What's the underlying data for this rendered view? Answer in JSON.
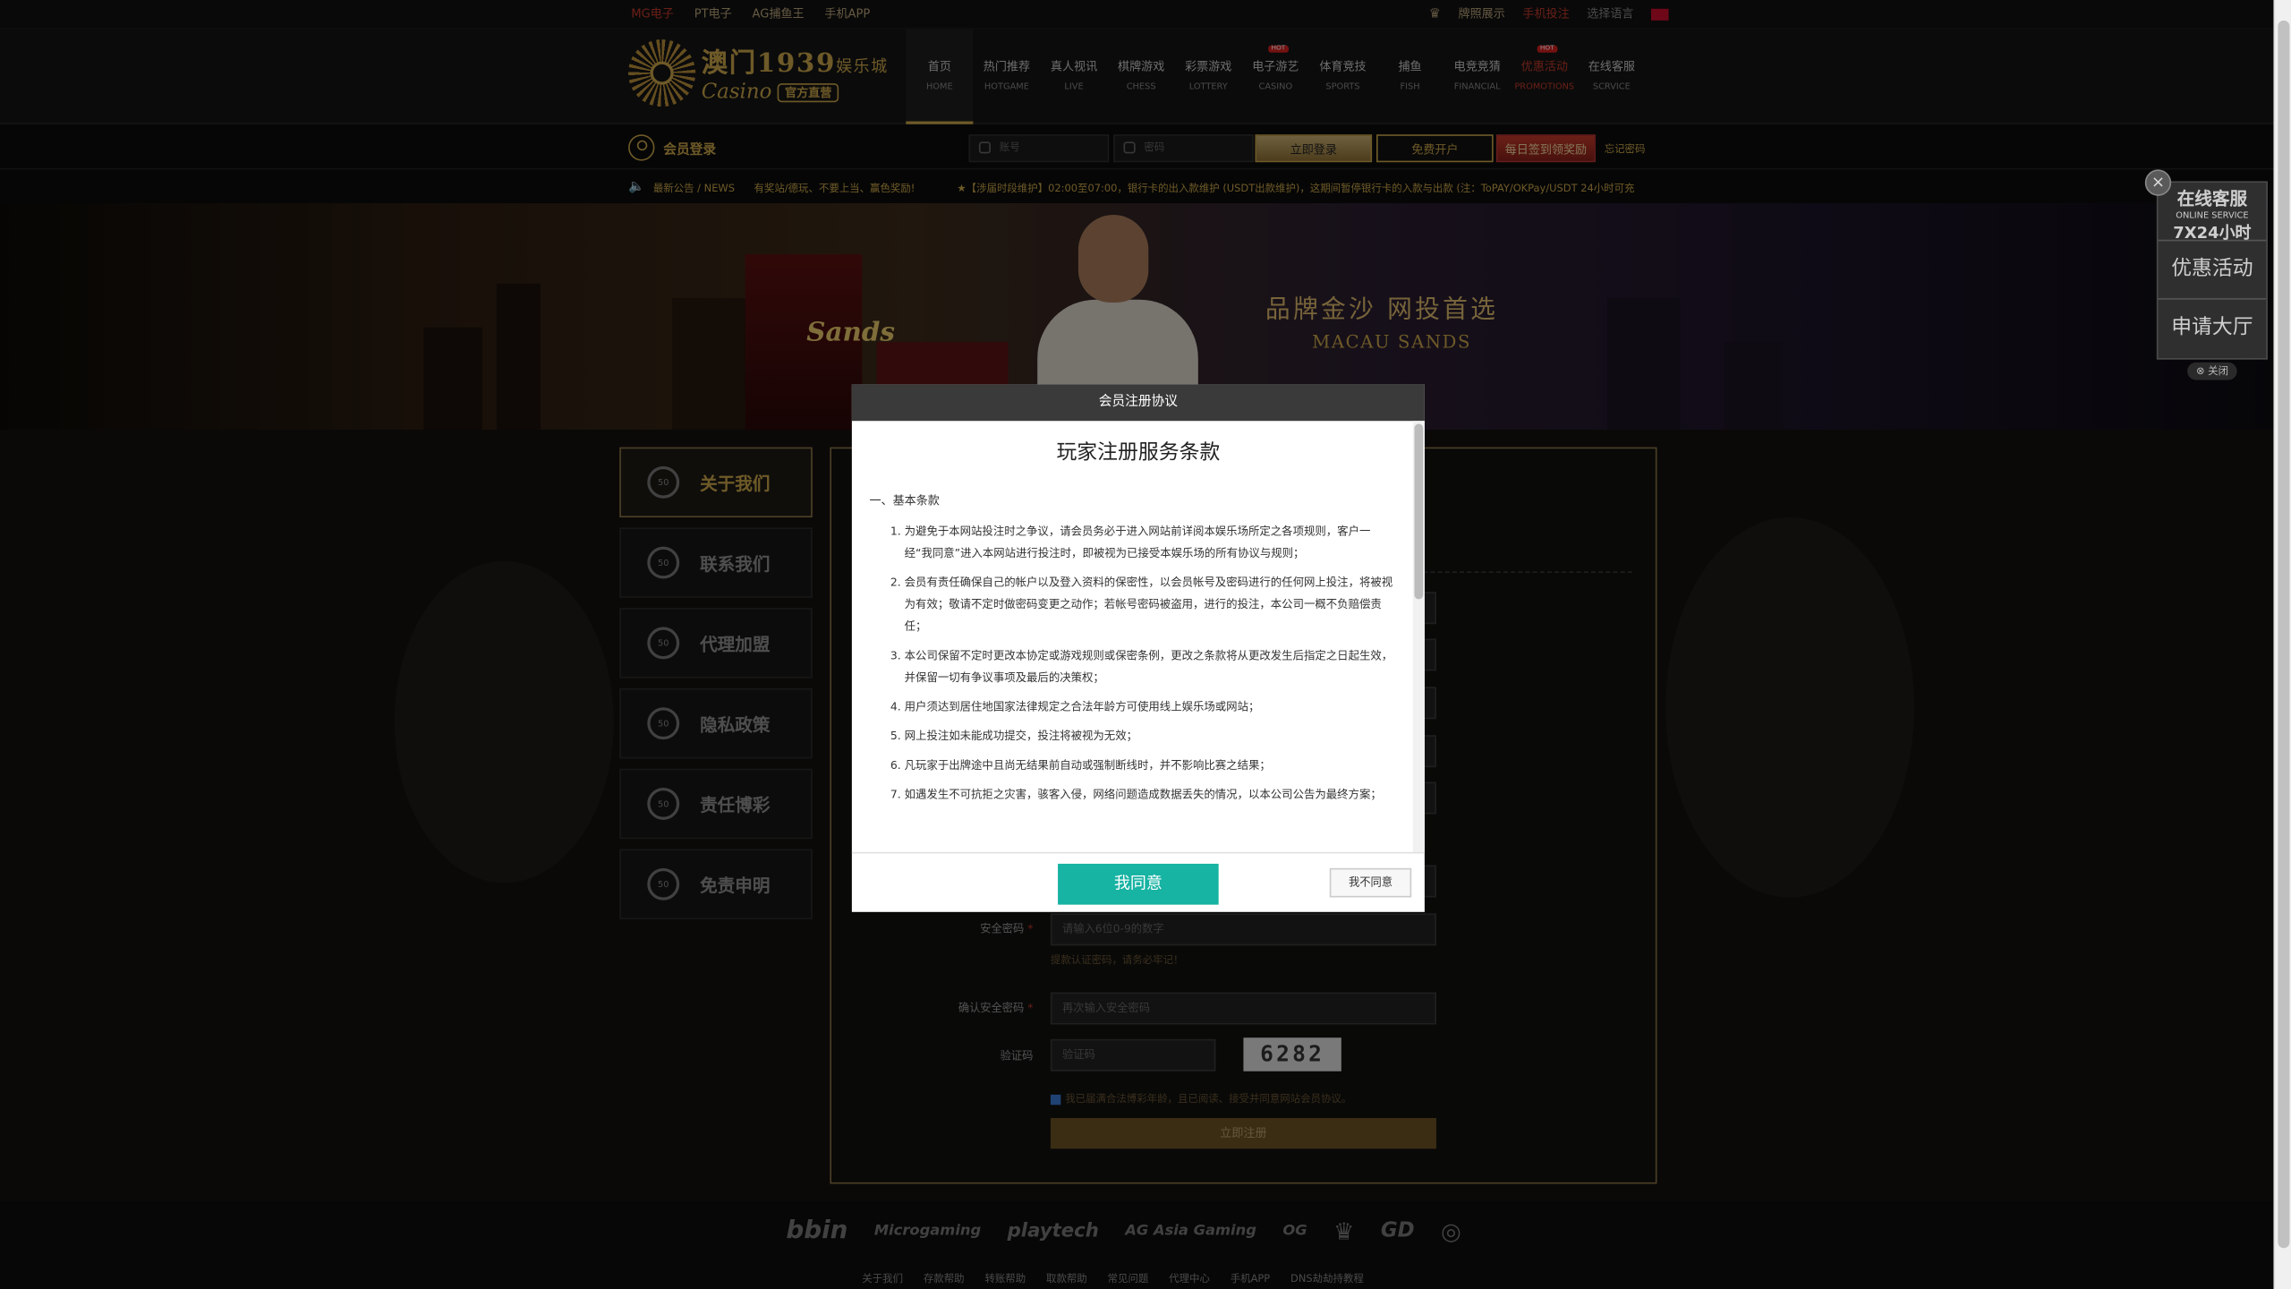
{
  "topbar": {
    "links": [
      "MG电子",
      "PT电子",
      "AG捕鱼王",
      "手机APP"
    ],
    "right": [
      "牌照展示",
      "手机投注",
      "选择语言"
    ]
  },
  "logo": {
    "main": "澳门1939",
    "suffix": "娱乐城",
    "casino": "Casino",
    "badge": "官方直营"
  },
  "nav": [
    {
      "zh": "首页",
      "en": "HOME"
    },
    {
      "zh": "热门推荐",
      "en": "HOTGAME"
    },
    {
      "zh": "真人视讯",
      "en": "LIVE"
    },
    {
      "zh": "棋牌游戏",
      "en": "CHESS"
    },
    {
      "zh": "彩票游戏",
      "en": "LOTTERY"
    },
    {
      "zh": "电子游艺",
      "en": "CASINO",
      "hot": "HOT"
    },
    {
      "zh": "体育竞技",
      "en": "SPORTS"
    },
    {
      "zh": "捕鱼",
      "en": "FISH"
    },
    {
      "zh": "电竞竞猜",
      "en": "FINANCIAL"
    },
    {
      "zh": "优惠活动",
      "en": "PROMOTIONS",
      "hot": "HOT"
    },
    {
      "zh": "在线客服",
      "en": "SCRVICE"
    }
  ],
  "login": {
    "member_label": "会员登录",
    "account_placeholder": "账号",
    "password_placeholder": "密码",
    "login_button": "立即登录",
    "register_button": "免费开户",
    "signin_button": "每日签到领奖励",
    "forgot": "忘记密码"
  },
  "news": {
    "label": "最新公告 / NEWS",
    "msg1": "有奖站/德玩、不要上当、赢色奖励!",
    "msg2": "★【涉届时段维护】02:00至07:00，银行卡的出入款维护 (USDT出款维护)，这期间暂停银行卡的入款与出款 (注：ToPAY/OKPay/USDT 24小时可充"
  },
  "banner": {
    "brand": "Sands",
    "slogan": "品牌金沙  网投首选",
    "slogan_en": "MACAU SANDS"
  },
  "sidebar": [
    {
      "label": "关于我们"
    },
    {
      "label": "联系我们"
    },
    {
      "label": "代理加盟"
    },
    {
      "label": "隐私政策"
    },
    {
      "label": "责任博彩"
    },
    {
      "label": "免责申明"
    }
  ],
  "chip_text": "50",
  "form": {
    "safe_pwd_label": "安全密码",
    "safe_pwd_placeholder": "请输入6位0-9的数字",
    "safe_pwd_hint": "提款认证密码，请务必牢记！",
    "confirm_label": "确认安全密码",
    "confirm_placeholder": "再次输入安全密码",
    "captcha_label": "验证码",
    "captcha_placeholder": "验证码",
    "captcha_value": "6282",
    "agree_text": "我已届满合法博彩年龄，且已阅读、接受并同意网站会员协议。",
    "submit": "立即注册"
  },
  "partners": [
    "bbin",
    "Microgaming",
    "playtech",
    "AG Asia Gaming",
    "OG",
    "♛",
    "GD",
    "◎"
  ],
  "footer_links": [
    "关于我们",
    "存款帮助",
    "转账帮助",
    "取款帮助",
    "常见问题",
    "代理中心",
    "手机APP",
    "DNS劫劫持教程"
  ],
  "float": {
    "service_zh": "在线客服",
    "service_en": "ONLINE SERVICE",
    "service_hours": "7X24小时",
    "promo": "优惠活动",
    "apply": "申请大厅",
    "close": "关闭"
  },
  "modal": {
    "header": "会员注册协议",
    "title": "玩家注册服务条款",
    "section": "一、基本条款",
    "items": [
      "为避免于本网站投注时之争议，请会员务必于进入网站前详阅本娱乐场所定之各项规则，客户一经“我同意”进入本网站进行投注时，即被视为已接受本娱乐场的所有协议与规则；",
      "会员有责任确保自己的帐户以及登入资料的保密性，以会员帐号及密码进行的任何网上投注，将被视为有效；敬请不定时做密码变更之动作；若帐号密码被盗用，进行的投注，本公司一概不负赔偿责任；",
      "本公司保留不定时更改本协定或游戏规则或保密条例，更改之条款将从更改发生后指定之日起生效，并保留一切有争议事项及最后的决策权；",
      "用户须达到居住地国家法律规定之合法年龄方可使用线上娱乐场或网站；",
      "网上投注如未能成功提交，投注将被视为无效；",
      "凡玩家于出牌途中且尚无结果前自动或强制断线时，并不影响比赛之结果；",
      "如遇发生不可抗拒之灾害，骇客入侵，网络问题造成数据丢失的情况，以本公司公告为最终方案；"
    ],
    "agree": "我同意",
    "disagree": "我不同意"
  }
}
